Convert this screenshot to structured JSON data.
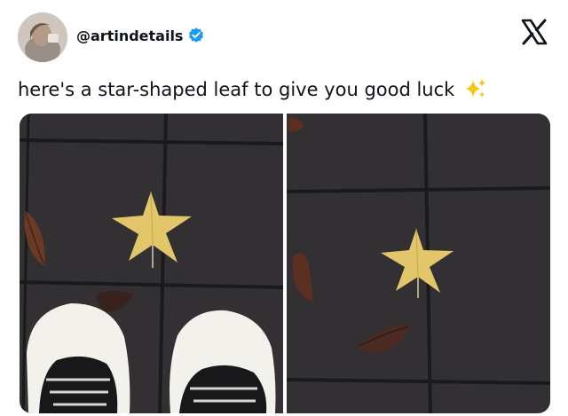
{
  "tweet": {
    "handle": "@artindetails",
    "verified": true,
    "text": "here's a star-shaped leaf to give you good luck",
    "emoji": "sparkles-icon",
    "brand": "X"
  },
  "media": {
    "count": 2,
    "items": [
      {
        "description_icon": "photo-feet-and-star-leaf"
      },
      {
        "description_icon": "photo-star-leaf-on-pavement"
      }
    ]
  },
  "colors": {
    "text": "#0f1419",
    "verified_blue": "#1d9bf0",
    "sparkle": "#f5c518",
    "pavement": "#2b2a2b",
    "leaf": "#e3c56a"
  }
}
